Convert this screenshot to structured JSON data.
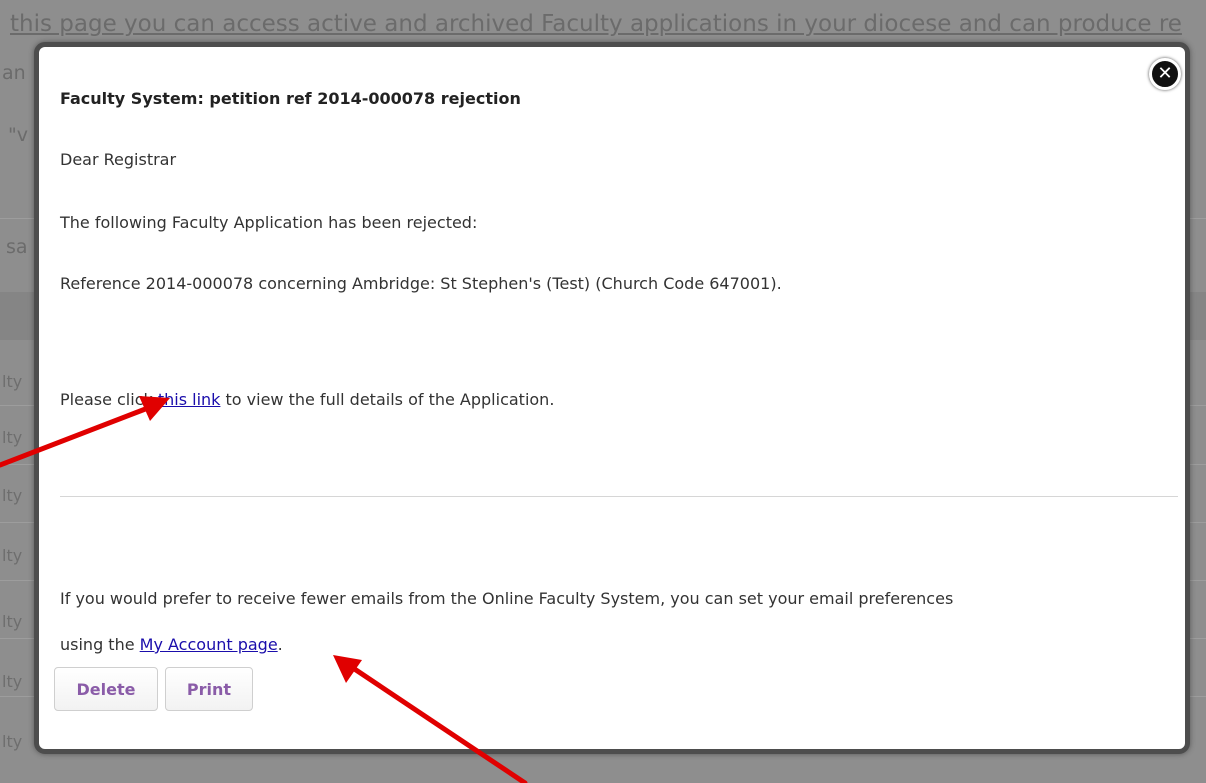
{
  "background": {
    "intro_text": "this page you can access active and archived Faculty applications in your diocese and can produce re",
    "fragments": [
      "an",
      "\"v",
      "sa"
    ],
    "row_label": "lty"
  },
  "modal": {
    "subject": "Faculty System: petition ref 2014-000078 rejection",
    "greeting": "Dear Registrar",
    "line1": "The following Faculty Application has been rejected:",
    "line2": "Reference 2014-000078 concerning Ambridge: St Stephen's (Test) (Church Code 647001).",
    "click_prefix": "Please click ",
    "click_link": "this link",
    "click_suffix": " to view the full details of the Application.",
    "prefs_line1": "If you would prefer to receive fewer emails from the Online Faculty System, you can set your email preferences",
    "prefs_prefix": "using the ",
    "prefs_link": "My Account page",
    "prefs_suffix": ".",
    "close_icon": "close-icon",
    "delete_label": "Delete",
    "print_label": "Print"
  },
  "colors": {
    "link": "#1a0dab",
    "button_text": "#8a5ca8",
    "arrow": "#e00000"
  }
}
